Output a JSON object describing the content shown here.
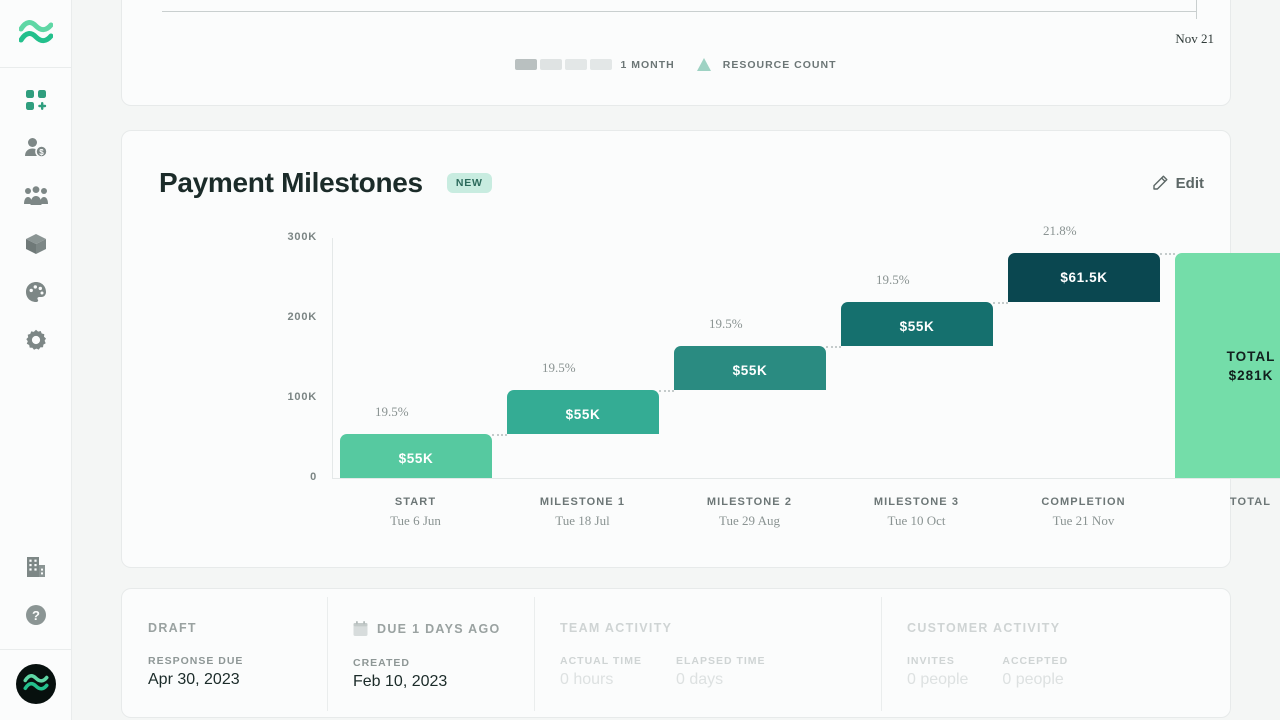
{
  "sidebar": {
    "logo_icon": "wave-logo-icon",
    "items": [
      {
        "icon": "dashboard-grid-add-icon",
        "name": "dashboard"
      },
      {
        "icon": "user-dollar-icon",
        "name": "clients"
      },
      {
        "icon": "team-people-icon",
        "name": "team"
      },
      {
        "icon": "package-box-icon",
        "name": "products"
      },
      {
        "icon": "palette-icon",
        "name": "branding"
      },
      {
        "icon": "gear-icon",
        "name": "settings"
      }
    ],
    "bottom_items": [
      {
        "icon": "building-icon",
        "name": "company"
      },
      {
        "icon": "help-circle-icon",
        "name": "help"
      }
    ],
    "avatar_icon": "wave-avatar-icon"
  },
  "gantt_card": {
    "end_date_label": "Nov 21",
    "scale_label": "1 MONTH",
    "resource_label": "RESOURCE COUNT",
    "triangle_icon": "triangle-marker-icon",
    "scale_icon": "gradient-scale-icon"
  },
  "milestones": {
    "title": "Payment Milestones",
    "badge": "NEW",
    "edit_label": "Edit",
    "edit_icon": "pencil-icon"
  },
  "chart_data": {
    "type": "bar",
    "title": "Payment Milestones",
    "subtitle": "",
    "xlabel": "",
    "ylabel": "",
    "ylim": [
      0,
      300000
    ],
    "ytick_labels": [
      "0",
      "100K",
      "200K",
      "300K"
    ],
    "ytick_values": [
      0,
      100000,
      200000,
      300000
    ],
    "grid": false,
    "legend": "none",
    "waterfall": true,
    "categories": [
      "START",
      "MILESTONE 1",
      "MILESTONE 2",
      "MILESTONE 3",
      "COMPLETION",
      "TOTAL"
    ],
    "category_dates": [
      "Tue 6 Jun",
      "Tue 18 Jul",
      "Tue 29 Aug",
      "Tue 10 Oct",
      "Tue 21 Nov",
      ""
    ],
    "values": [
      55000,
      55000,
      55000,
      55000,
      61500,
      281000
    ],
    "value_labels": [
      "$55K",
      "$55K",
      "$55K",
      "$55K",
      "$61.5K",
      "$281K"
    ],
    "percent_labels": [
      "19.5%",
      "19.5%",
      "19.5%",
      "19.5%",
      "21.8%",
      ""
    ],
    "cumulative_base": [
      0,
      55000,
      110000,
      165000,
      220000,
      0
    ],
    "total_label": "TOTAL",
    "total_value_label": "$281K",
    "colors": [
      "#56c9a0",
      "#34ac94",
      "#2a8b81",
      "#15706e",
      "#0a4750",
      "#74dda9"
    ]
  },
  "stats": {
    "draft": {
      "status": "DRAFT",
      "label": "RESPONSE DUE",
      "value": "Apr 30, 2023"
    },
    "due": {
      "status": "DUE 1 DAYS AGO",
      "icon": "calendar-icon",
      "label": "CREATED",
      "value": "Feb 10, 2023"
    },
    "team": {
      "heading": "TEAM ACTIVITY",
      "cells": [
        {
          "label": "ACTUAL TIME",
          "value": "0 hours"
        },
        {
          "label": "ELAPSED TIME",
          "value": "0 days"
        }
      ]
    },
    "customer": {
      "heading": "CUSTOMER ACTIVITY",
      "cells": [
        {
          "label": "INVITES",
          "value": "0 people"
        },
        {
          "label": "ACCEPTED",
          "value": "0 people"
        }
      ]
    }
  },
  "colors": {
    "accent": "#35c08f",
    "card_bg": "#fbfcfc",
    "page_bg": "#f4f6f5",
    "badge_bg": "#c8ece0",
    "badge_fg": "#2c6b5c"
  }
}
